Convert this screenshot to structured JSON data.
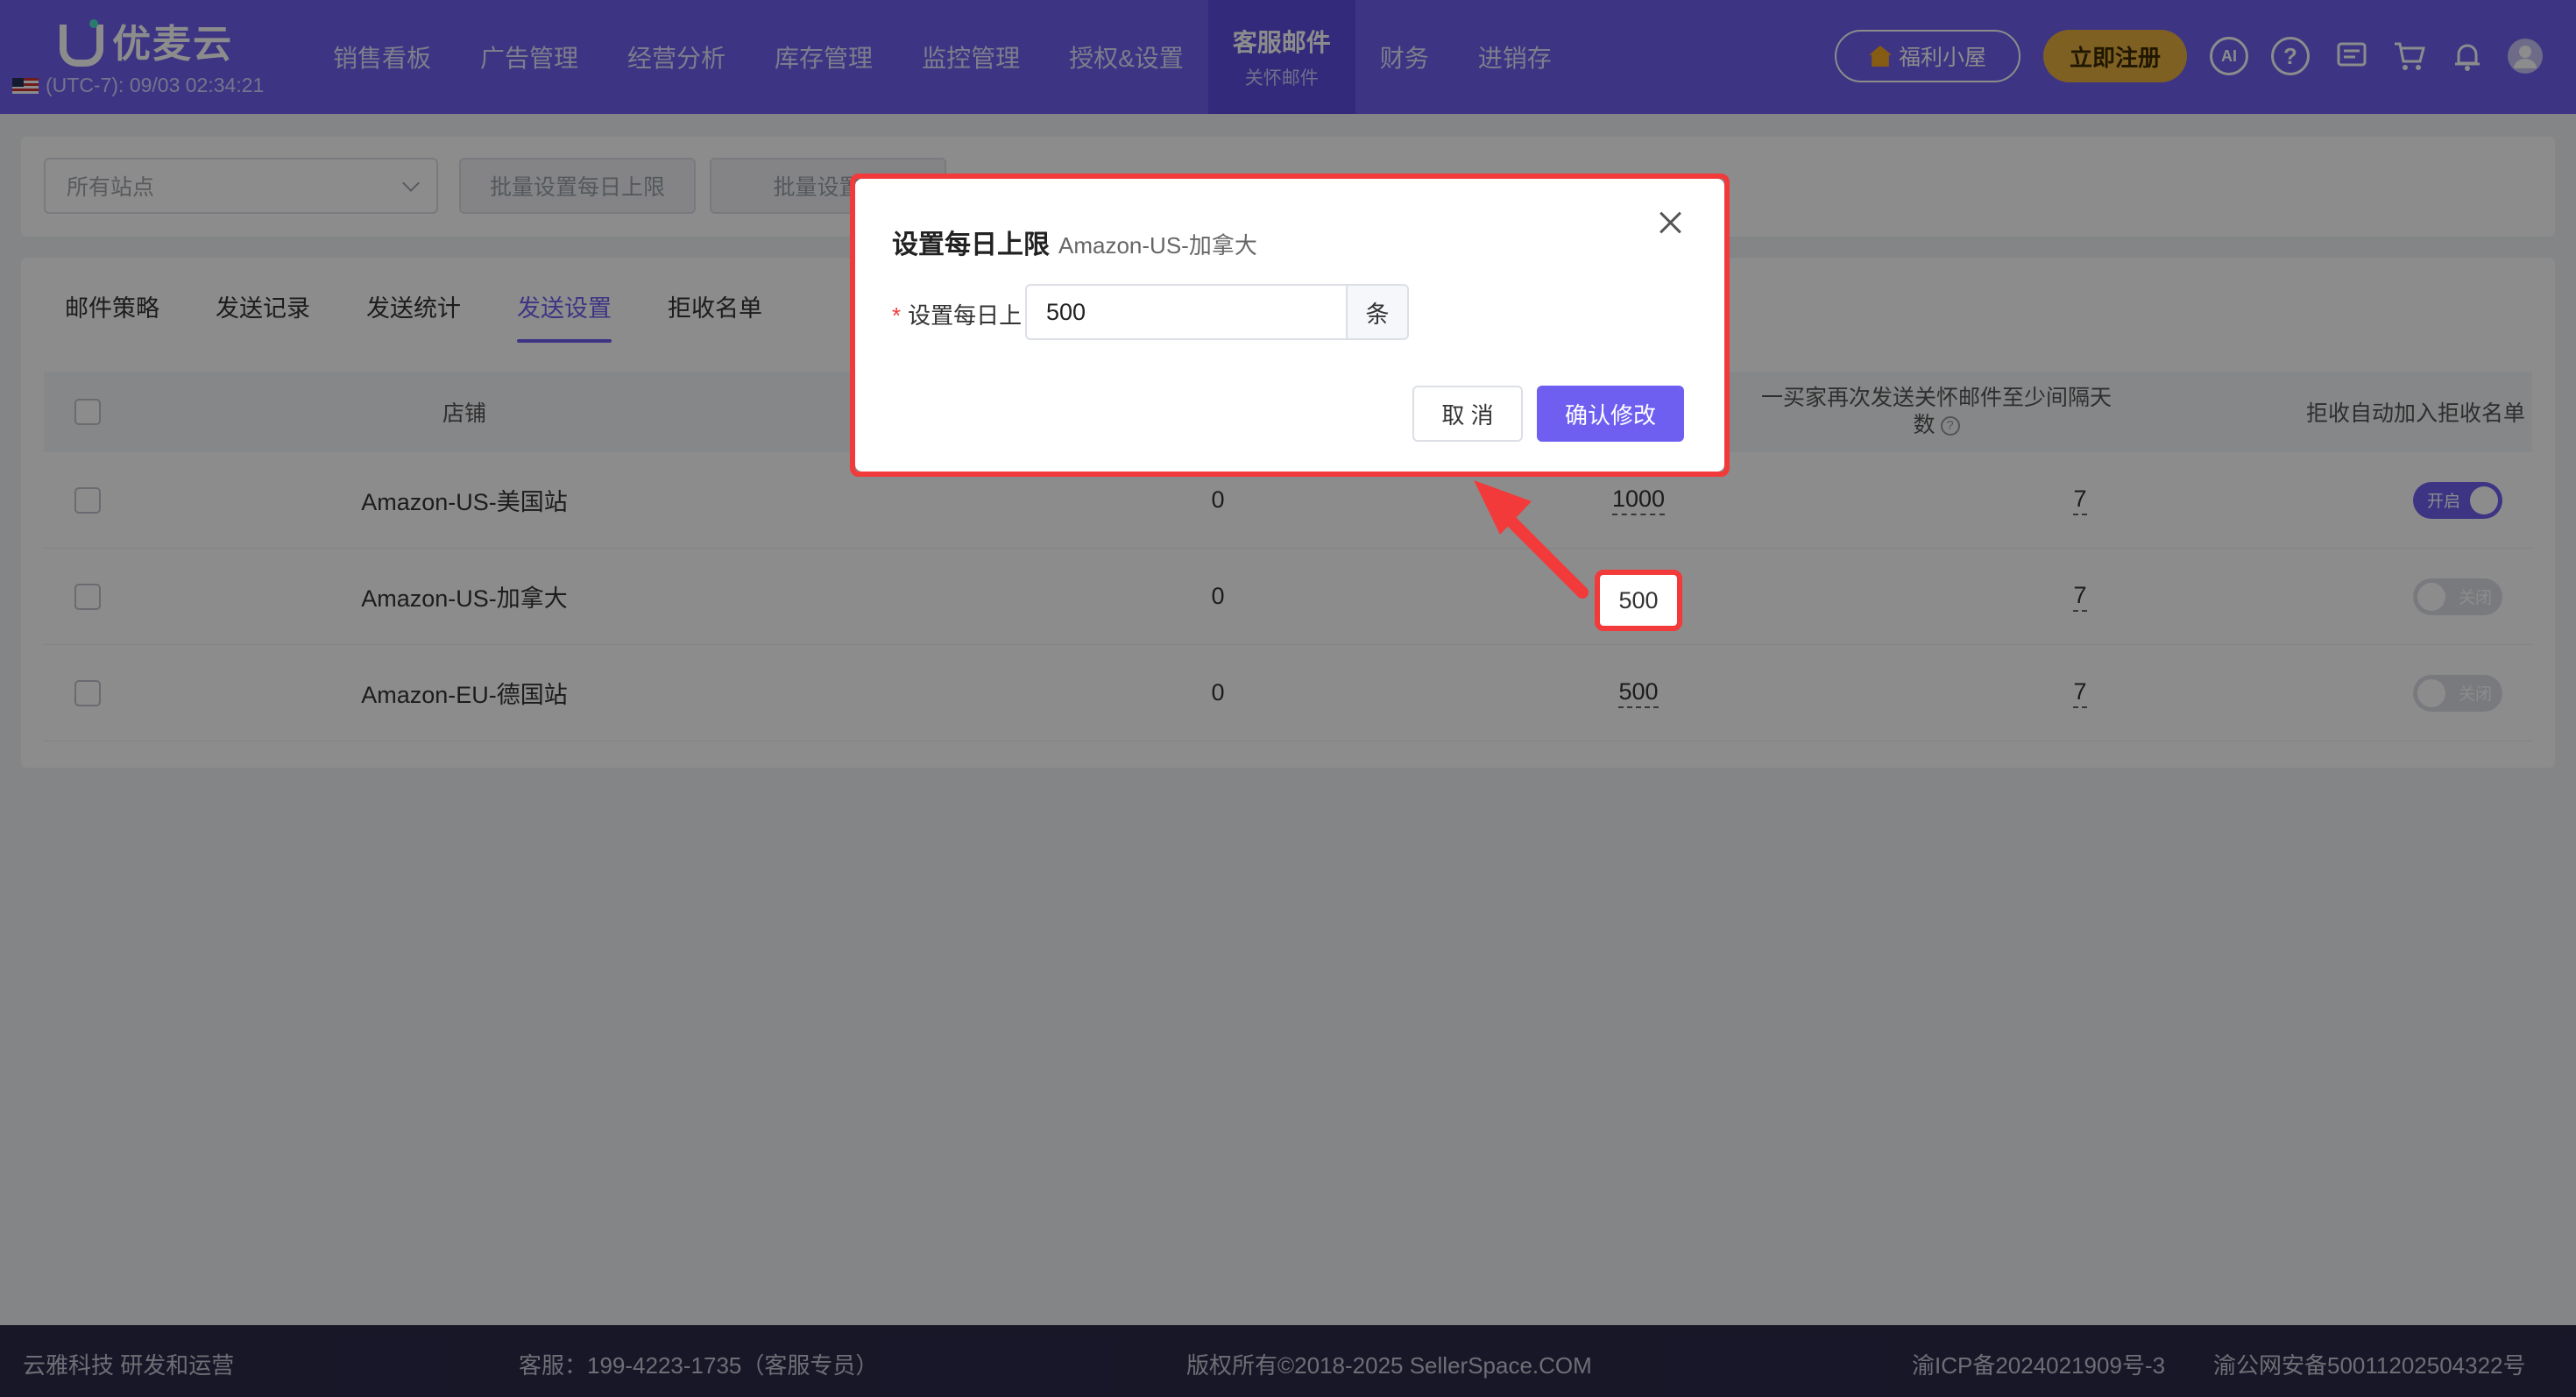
{
  "header": {
    "logo_text": "优麦云",
    "clock": "(UTC-7): 09/03 02:34:21",
    "nav": [
      {
        "label": "销售看板"
      },
      {
        "label": "广告管理"
      },
      {
        "label": "经营分析"
      },
      {
        "label": "库存管理"
      },
      {
        "label": "监控管理"
      },
      {
        "label": "授权&设置"
      },
      {
        "label": "客服邮件",
        "sub": "关怀邮件",
        "active": true
      },
      {
        "label": "财务"
      },
      {
        "label": "进销存"
      }
    ],
    "welfare_label": "福利小屋",
    "register_label": "立即注册",
    "icons": [
      "ai-icon",
      "help-icon",
      "message-icon",
      "cart-icon",
      "bell-icon",
      "avatar-icon"
    ]
  },
  "filter": {
    "site_placeholder": "所有站点",
    "batch_daily_limit": "批量设置每日上限",
    "batch_other": "批量设置发"
  },
  "tabs": [
    {
      "label": "邮件策略"
    },
    {
      "label": "发送记录"
    },
    {
      "label": "发送统计"
    },
    {
      "label": "发送设置",
      "active": true
    },
    {
      "label": "拒收名单"
    }
  ],
  "table": {
    "headers": {
      "store": "店铺",
      "interval_line1": "一买家再次发送关怀邮件至少间隔天",
      "interval_line2": "数",
      "reject_auto": "拒收自动加入拒收名单"
    },
    "rows": [
      {
        "store": "Amazon-US-美国站",
        "sent": "0",
        "daily_limit": "1000",
        "interval": "7",
        "reject_toggle": "开启",
        "reject_on": true
      },
      {
        "store": "Amazon-US-加拿大",
        "sent": "0",
        "daily_limit": "500",
        "interval": "7",
        "reject_toggle": "关闭",
        "reject_on": false
      },
      {
        "store": "Amazon-EU-德国站",
        "sent": "0",
        "daily_limit": "500",
        "interval": "7",
        "reject_toggle": "关闭",
        "reject_on": false
      }
    ]
  },
  "modal": {
    "title": "设置每日上限",
    "subtitle": "Amazon-US-加拿大",
    "field_label": "设置每日上",
    "field_value": "500",
    "field_suffix": "条",
    "cancel_label": "取 消",
    "confirm_label": "确认修改"
  },
  "footer": {
    "company": "云雅科技 研发和运营",
    "service": "客服：199-4223-1735（客服专员）",
    "copyright": "版权所有©2018-2025 SellerSpace.COM",
    "icp": "渝ICP备2024021909号-3",
    "police": "渝公网安备50011202504322号"
  },
  "colors": {
    "accent": "#6f5ff0",
    "highlight": "#f23a3a"
  }
}
